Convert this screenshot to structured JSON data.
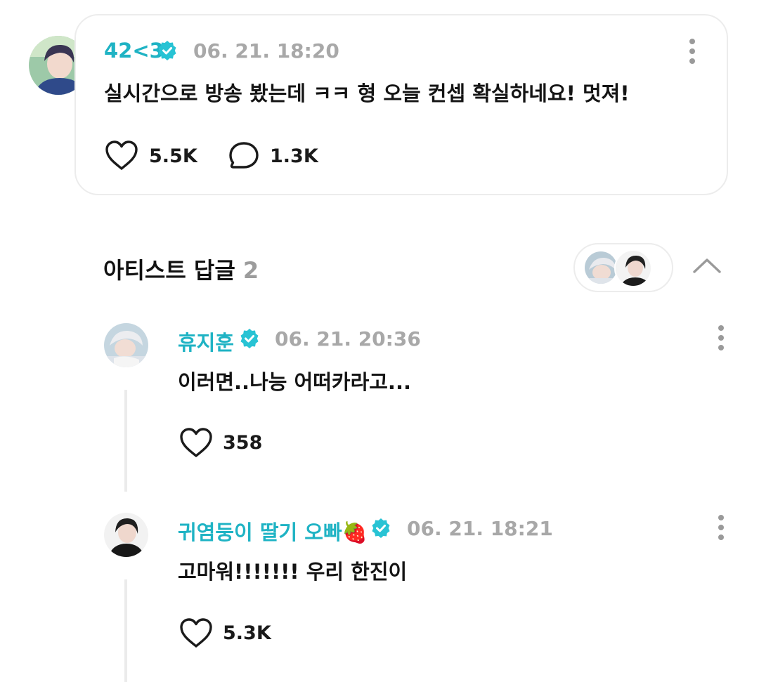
{
  "colors": {
    "accent": "#1fb3c4",
    "verified": "#28c3d4",
    "timestamp": "#a8a8a8",
    "border": "#ececec",
    "icon": "#1a1a1a"
  },
  "icons": {
    "verified": "verified-badge-icon",
    "like": "heart-icon",
    "comment": "speech-bubble-icon",
    "more": "more-vertical-icon",
    "collapse": "chevron-up-icon",
    "emoji": "strawberry-icon"
  },
  "post": {
    "author": "42<3",
    "time": "06. 21. 18:20",
    "text": "실시간으로 방송 봤는데 ㅋㅋ 형 오늘 컨셉 확실하네요! 멋져!",
    "likes": "5.5K",
    "comments": "1.3K"
  },
  "artist_replies": {
    "title": "아티스트 답글",
    "count": "2"
  },
  "replies": [
    {
      "author": "휴지훈",
      "time": "06. 21. 20:36",
      "text": "이러면..나능 어떠카라고...",
      "likes": "358"
    },
    {
      "author": "귀염둥이 딸기 오빠",
      "emoji": "🍓",
      "time": "06. 21. 18:21",
      "text": "고마워!!!!!!! 우리 한진이",
      "likes": "5.3K"
    }
  ]
}
